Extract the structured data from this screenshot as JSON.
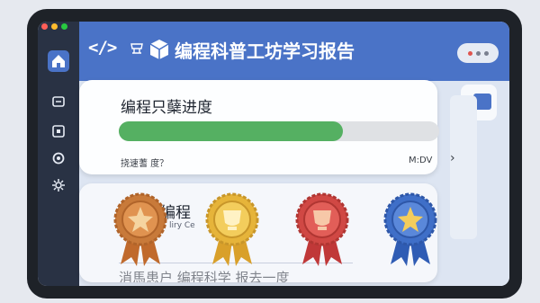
{
  "colors": {
    "header": "#4a73c7",
    "rail": "#293244",
    "progress_fill": "#55b062",
    "progress_track": "#dfe1e4"
  },
  "window": {
    "dots": [
      "#ff5f57",
      "#febc2e",
      "#28c840"
    ]
  },
  "sidebar": {
    "items": [
      {
        "icon": "home-icon",
        "active": true
      },
      {
        "icon": "message-icon"
      },
      {
        "icon": "square-icon"
      },
      {
        "icon": "refresh-icon"
      },
      {
        "icon": "gear-icon"
      }
    ]
  },
  "header": {
    "code_icon_text": "</>",
    "title": "编程科普工坊学习报告",
    "icons": [
      "code-icon",
      "shop-icon",
      "cube-icon"
    ]
  },
  "progress_card": {
    "title": "编程只蘖进度",
    "progress": 0.7,
    "footer_left": "挠速蓍  度？",
    "footer_right": "M:DV",
    "chevron": "›"
  },
  "badges_card": {
    "title": "编程",
    "subtitle": "liry Ce",
    "bottom_text": "消馬患户   编程科学    报去一度",
    "badges": [
      {
        "name": "bronze",
        "color": "#c87a3a",
        "ribbon": "#c06a2c"
      },
      {
        "name": "gold",
        "color": "#e6b43a",
        "ribbon": "#d9a02a"
      },
      {
        "name": "ruby",
        "color": "#d04844",
        "ribbon": "#c03838"
      },
      {
        "name": "sapphire",
        "color": "#3f6fc8",
        "ribbon": "#2f5cb4"
      }
    ]
  }
}
